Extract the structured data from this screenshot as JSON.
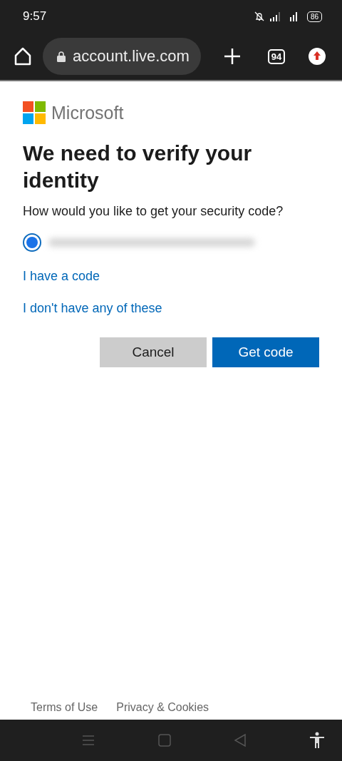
{
  "status_bar": {
    "time": "9:57",
    "battery": "86"
  },
  "browser": {
    "url": "account.live.com",
    "tab_count": "94"
  },
  "page": {
    "brand": "Microsoft",
    "title": "We need to verify your identity",
    "question": "How would you like to get your security code?",
    "options": [
      {
        "kind": "redacted",
        "selected": true
      }
    ],
    "links": [
      "I have a code",
      "I don't have any of these"
    ],
    "buttons": [
      {
        "label": "Cancel",
        "kind": "secondary"
      },
      {
        "label": "Get code",
        "kind": "primary"
      }
    ],
    "footer": [
      "Terms of Use",
      "Privacy & Cookies"
    ]
  }
}
